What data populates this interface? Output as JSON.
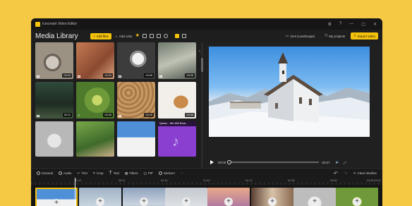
{
  "window": {
    "title": "Icecream Video Editor",
    "controls": [
      "⚙",
      "?",
      "—",
      "▢",
      "✕"
    ]
  },
  "toolbar": {
    "library_title": "Media Library",
    "add_files": "Add files",
    "add_color": "Add color",
    "aspect": "16:9 (Landscape)",
    "my_projects": "My projects",
    "export": "Export video"
  },
  "library": {
    "thumbs": [
      {
        "duration": "00:04",
        "icon": "camera"
      },
      {
        "duration": "00:24",
        "icon": "camera"
      },
      {
        "duration": "00:05",
        "icon": "camera"
      },
      {
        "duration": "00:06",
        "icon": "camera"
      },
      {
        "duration": "00:11",
        "icon": "camera"
      },
      {
        "duration": "00:26",
        "icon": "check"
      },
      {
        "duration": "00:15",
        "icon": "camera"
      },
      {
        "duration": "00:05",
        "icon": "check-camera"
      },
      {
        "duration": "",
        "icon": ""
      },
      {
        "duration": "",
        "icon": ""
      },
      {
        "duration": "",
        "icon": ""
      },
      {
        "playlist": "Queen - We Will Rock...",
        "icon": "music-note-icon"
      }
    ]
  },
  "player": {
    "current_time": "00:00",
    "total_time": "02:57",
    "progress": 0.0
  },
  "edit_tools": [
    "General",
    "Audio",
    "Trim",
    "Crop",
    "Text",
    "Filters",
    "PiP",
    "Stickers"
  ],
  "clear_timeline": "Clear timeline",
  "timeline": {
    "ticks": [
      "00:12",
      "00:41",
      "01:10",
      "01:40",
      "02:10",
      "02:38",
      "03:06",
      "03:36",
      "04:04"
    ]
  },
  "colors": {
    "background": "#f6c945",
    "accent": "#f4c20d",
    "panel": "#1e1e1e"
  }
}
